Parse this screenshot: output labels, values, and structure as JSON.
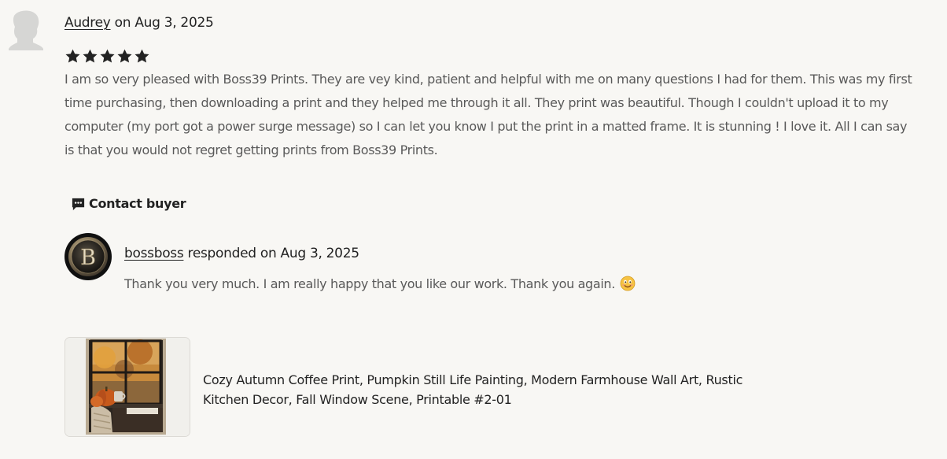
{
  "review": {
    "reviewer_name": "Audrey",
    "date_text": " on Aug 3, 2025",
    "rating": 5,
    "rating_max": 5,
    "text": "I am so very pleased with Boss39 Prints. They are vey kind, patient and helpful with me on many questions I had for them. This was my first time purchasing, then downloading a print and they helped me through it all. They print was beautiful. Though I couldn't upload it to my computer (my port got a power surge message) so I can let you know I put the print in a matted frame. It is stunning ! I love it. All I can say is that you would not regret getting prints from Boss39 Prints."
  },
  "contact_buyer": {
    "label": "Contact buyer"
  },
  "response": {
    "shop_name": "bossboss",
    "meta_text": " responded on Aug 3, 2025",
    "text": "Thank you very much. I am really happy that you like our work. Thank you again."
  },
  "product": {
    "title": "Cozy Autumn Coffee Print, Pumpkin Still Life Painting, Modern Farmhouse Wall Art, Rustic Kitchen Decor, Fall Window Scene, Printable #2-01"
  },
  "colors": {
    "star": "#222222",
    "text_primary": "#222222",
    "text_secondary": "#595959",
    "background": "#f8f7f4"
  },
  "icons": {
    "reviewer_avatar": "default-user-silhouette-icon",
    "star": "star-icon",
    "contact": "chat-bubble-icon",
    "emoji": "smiling-emoji-icon"
  }
}
